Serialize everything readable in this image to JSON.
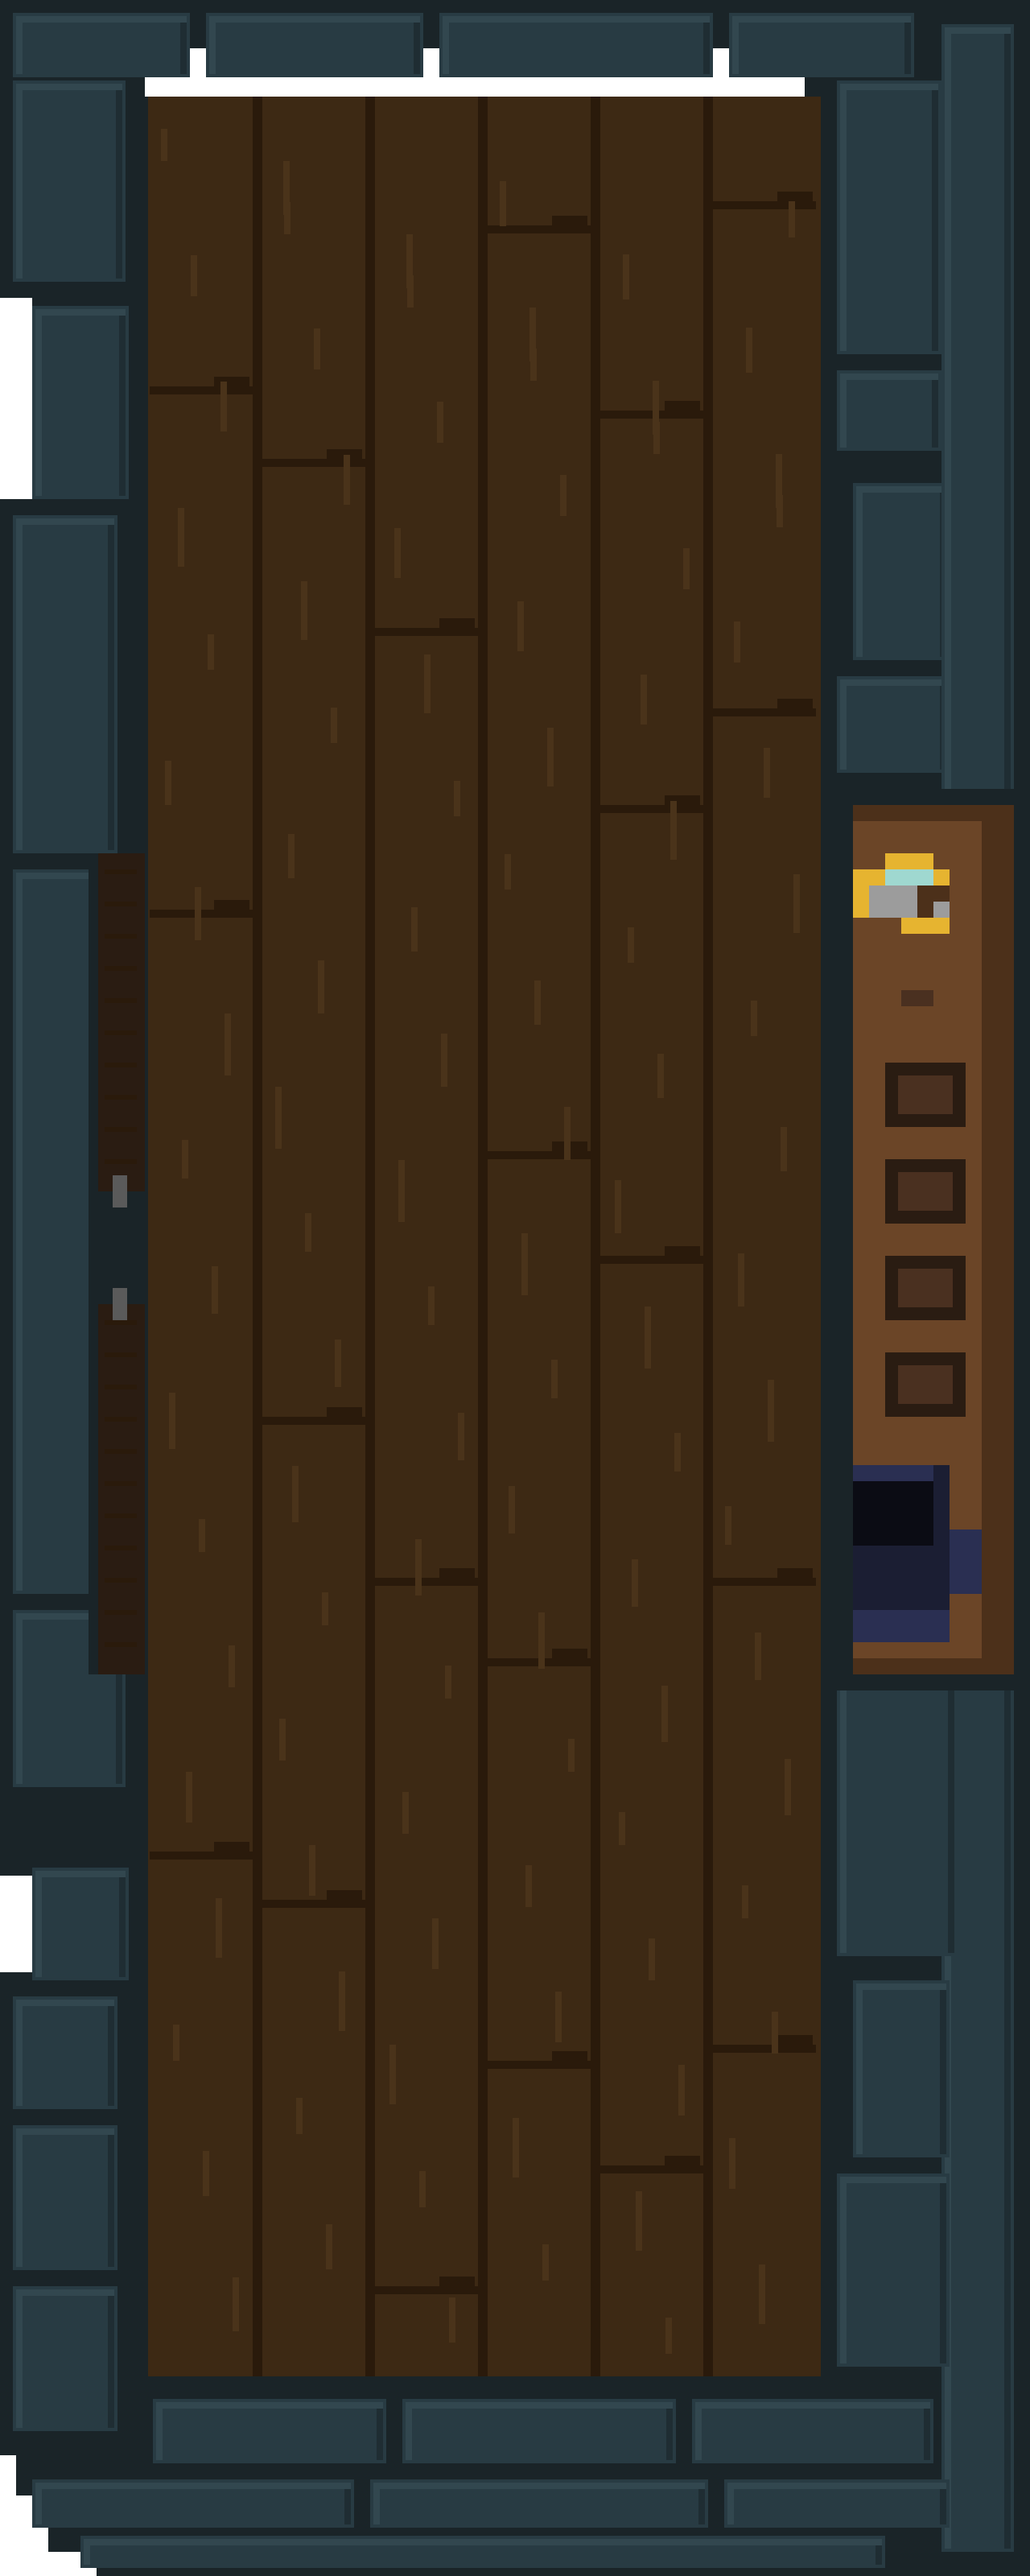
{
  "scene": {
    "name": "pixel-art-dungeon-room",
    "view": "top-down"
  },
  "palette": {
    "background": "#ffffff",
    "wall_outline": "#1a2428",
    "wall_dark": "#1f2d33",
    "wall_mid": "#283b43",
    "wall_light": "#32474f",
    "wall_highlight": "#3a5059",
    "floor_base": "#3d2914",
    "floor_dark": "#2e1d0c",
    "floor_seam": "#2a1a0b",
    "floor_grain": "#4a331a",
    "shelf_wood": "#6b4527",
    "shelf_dark": "#4c301a",
    "shelf_slot": "#3b2615",
    "shelf_slot_inner": "#4a3020",
    "door_dark": "#2a1c12",
    "door_stud": "#5a5a5a",
    "ring_gold": "#e6b430",
    "ring_gem": "#9fd8d0",
    "ring_silver": "#9c9c9c",
    "pot_dark": "#0b0c14",
    "pot_body": "#1b1e33",
    "pot_rim": "#2a2f52"
  },
  "room": {
    "walls": "stone-brick",
    "floor": "wooden-planks",
    "floor_planks": 6
  },
  "objects": {
    "left_door": {
      "type": "wooden-door",
      "side": "left",
      "studs": 2
    },
    "shelf": {
      "type": "wooden-shelf",
      "side": "right",
      "slots": 4
    },
    "ring": {
      "type": "gold-ring-with-gem",
      "location": "shelf-top"
    },
    "pot": {
      "type": "dark-cauldron",
      "location": "shelf-bottom"
    }
  }
}
